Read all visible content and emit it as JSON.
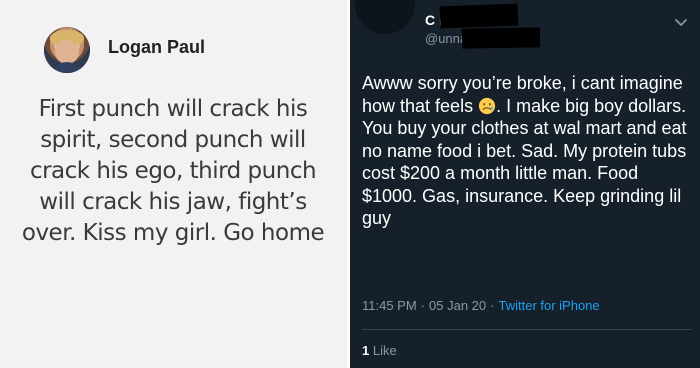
{
  "left_post": {
    "author": "Logan Paul",
    "quote": "First punch will crack his spirit, second punch will crack his ego, third punch will crack his jaw, fight’s over. Kiss my girl. Go home"
  },
  "right_tweet": {
    "display_name": "C          ne",
    "handle": "@unnacr",
    "body_part_1": "Awww sorry you’re broke, i cant imagine how that feels ",
    "emoji": "crying-face-icon",
    "body_part_2": ". I make big boy dollars. You buy your clothes at wal mart and eat no name food i bet. Sad. My protein tubs cost $200 a month little man. Food $1000. Gas, insurance. Keep grinding lil guy",
    "time": "11:45 PM",
    "separator": "·",
    "date": "05 Jan 20",
    "source": "Twitter for iPhone",
    "likes_count": "1",
    "likes_label": "Like"
  },
  "colors": {
    "left_bg": "#f2f2f2",
    "right_bg": "#15202b",
    "link": "#1da1f2",
    "muted": "#8899a6"
  }
}
